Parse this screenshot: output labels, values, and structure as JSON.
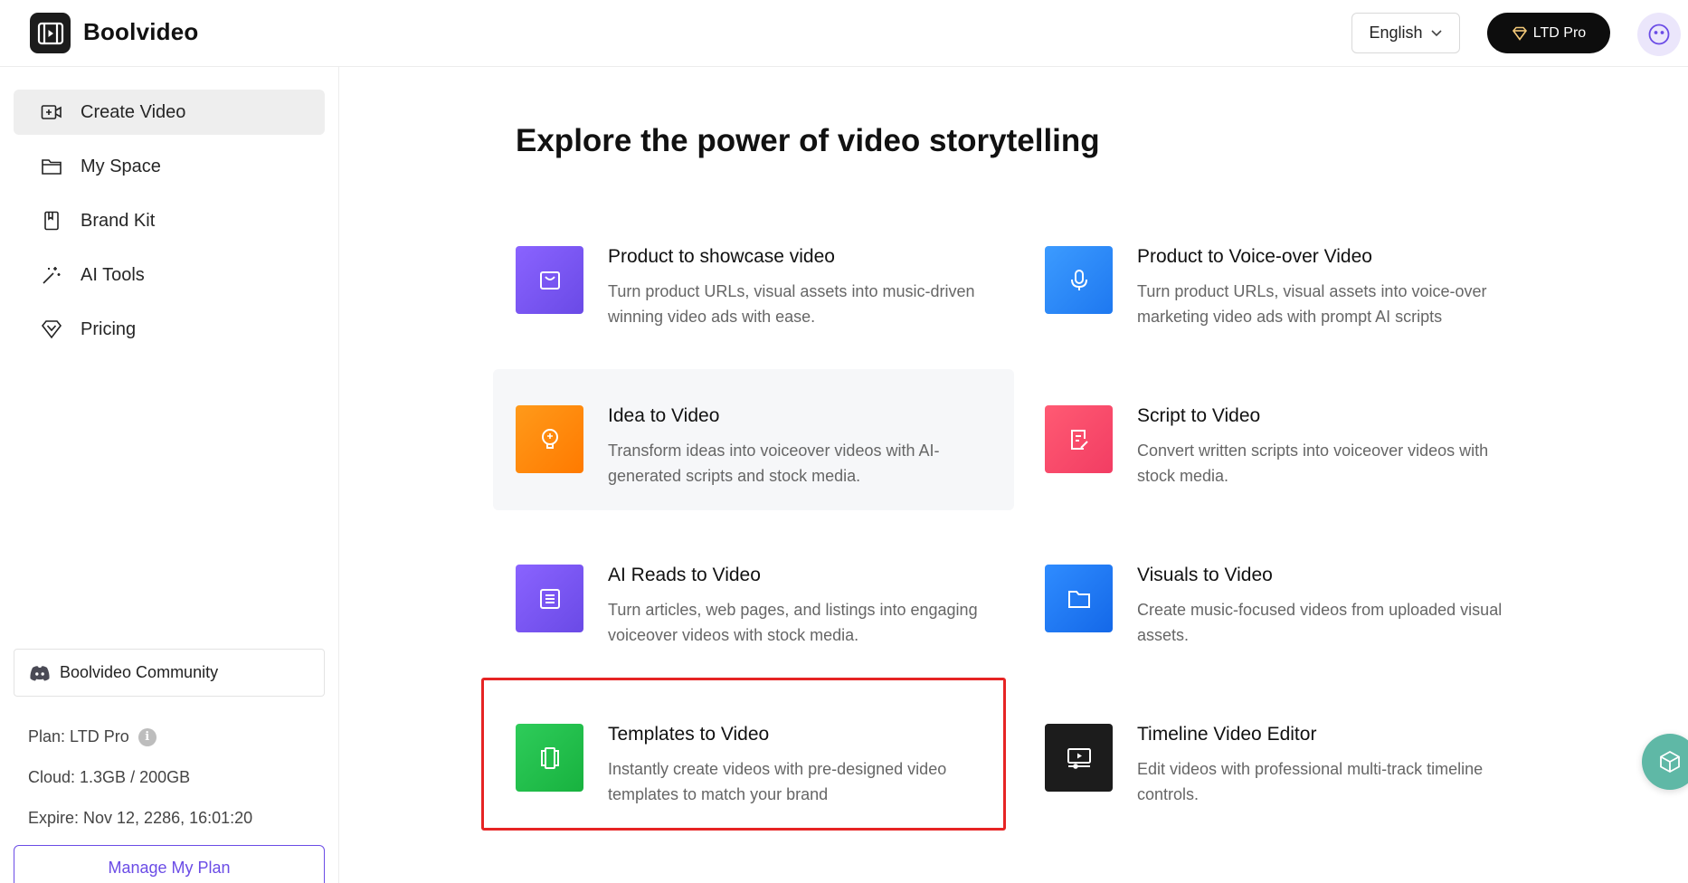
{
  "header": {
    "brand": "Boolvideo",
    "language": "English",
    "plan_button": "LTD Pro"
  },
  "sidebar": {
    "items": [
      {
        "label": "Create Video",
        "icon": "video-plus-icon",
        "active": true
      },
      {
        "label": "My Space",
        "icon": "folder-icon",
        "active": false
      },
      {
        "label": "Brand Kit",
        "icon": "bookmark-icon",
        "active": false
      },
      {
        "label": "AI Tools",
        "icon": "magic-wand-icon",
        "active": false
      },
      {
        "label": "Pricing",
        "icon": "diamond-icon",
        "active": false
      }
    ],
    "community": "Boolvideo Community",
    "plan": "Plan: LTD Pro",
    "cloud": "Cloud: 1.3GB / 200GB",
    "expire": "Expire: Nov 12, 2286, 16:01:20",
    "manage_button": "Manage My Plan"
  },
  "main": {
    "headline": "Explore the power of video storytelling",
    "cards": [
      {
        "title": "Product to showcase video",
        "description": "Turn product URLs, visual assets into music-driven winning video ads with ease.",
        "icon": "shopping-bag-icon",
        "color": "#7a5cf5"
      },
      {
        "title": "Product to Voice-over Video",
        "description": "Turn product URLs, visual assets into voice-over marketing video ads with prompt AI scripts",
        "icon": "microphone-icon",
        "color": "#2f8cff"
      },
      {
        "title": "Idea to Video",
        "description": "Transform ideas into voiceover videos with AI-generated scripts and stock media.",
        "icon": "lightbulb-icon",
        "color": "#ff8a00"
      },
      {
        "title": "Script to Video",
        "description": "Convert written scripts into voiceover videos with stock media.",
        "icon": "script-edit-icon",
        "color": "#ff4d6d"
      },
      {
        "title": "AI Reads to Video",
        "description": "Turn articles, web pages, and listings into engaging voiceover videos with stock media.",
        "icon": "article-icon",
        "color": "#7a5cf5"
      },
      {
        "title": "Visuals to Video",
        "description": "Create music-focused videos from uploaded visual assets.",
        "icon": "folder-icon",
        "color": "#1e7dff"
      },
      {
        "title": "Templates to Video",
        "description": "Instantly create videos with pre-designed video templates to match your brand",
        "icon": "template-icon",
        "color": "#22c04a"
      },
      {
        "title": "Timeline Video Editor",
        "description": "Edit videos with professional multi-track timeline controls.",
        "icon": "timeline-editor-icon",
        "color": "#1c1c1c"
      }
    ]
  }
}
